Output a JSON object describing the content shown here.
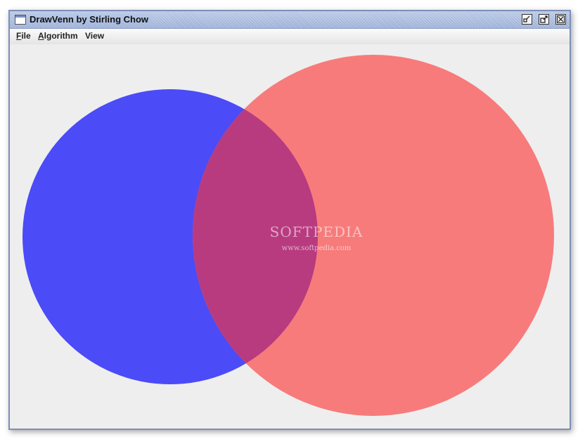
{
  "window": {
    "title": "DrawVenn by Stirling Chow"
  },
  "window_controls": {
    "minimize_icon": "minimize-icon",
    "maximize_icon": "maximize-icon",
    "close_icon": "close-icon"
  },
  "menu": {
    "items": [
      {
        "label": "File",
        "mnemonic": "F"
      },
      {
        "label": "Algorithm",
        "mnemonic": "A"
      },
      {
        "label": "View",
        "mnemonic": "V"
      }
    ]
  },
  "venn": {
    "set_a_color": "#4b4bf7",
    "set_b_color": "#f77b7b",
    "intersection_color": "#b83b80"
  },
  "watermark": {
    "brand": "SOFTPEDIA",
    "url": "www.softpedia.com"
  }
}
